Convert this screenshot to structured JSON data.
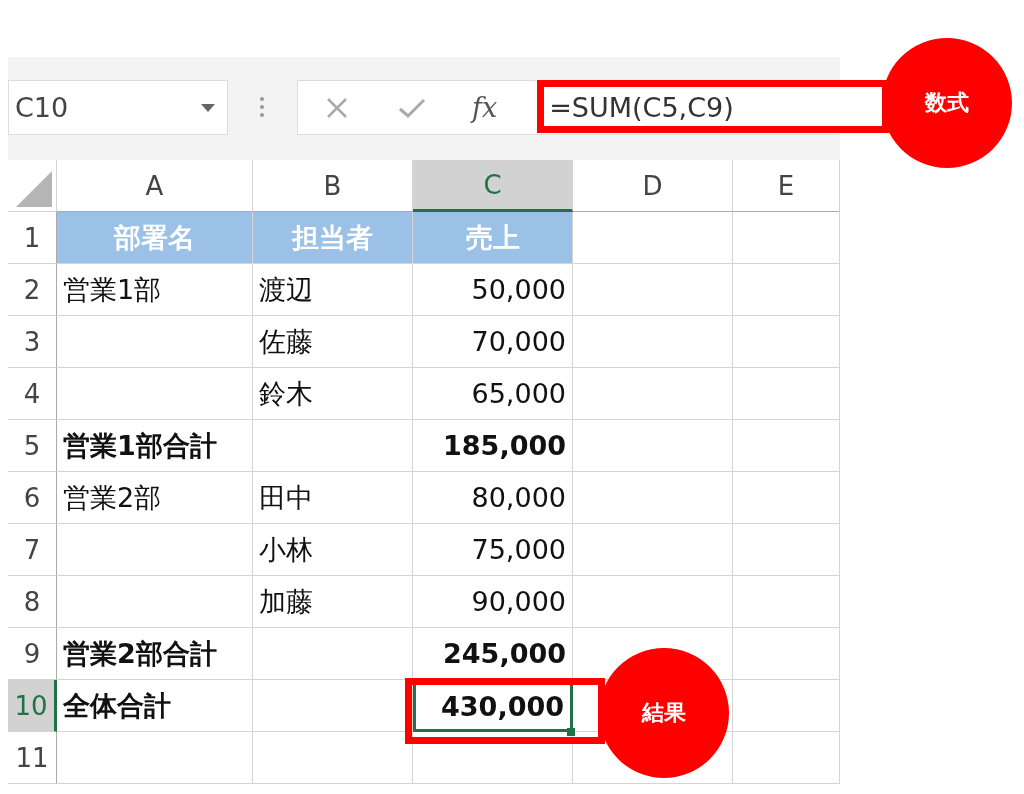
{
  "formula_bar": {
    "name_box": "C10",
    "function_button": "fx",
    "formula": "=SUM(C5,C9)"
  },
  "columns": [
    {
      "label": "A",
      "selected": false
    },
    {
      "label": "B",
      "selected": false
    },
    {
      "label": "C",
      "selected": true
    },
    {
      "label": "D",
      "selected": false
    },
    {
      "label": "E",
      "selected": false
    }
  ],
  "rows": [
    {
      "number": "1",
      "selected": false,
      "kind": "header",
      "dept": "部署名",
      "person": "担当者",
      "sales": "売上"
    },
    {
      "number": "2",
      "selected": false,
      "kind": "data",
      "dept": "営業1部",
      "person": "渡辺",
      "sales": "50,000"
    },
    {
      "number": "3",
      "selected": false,
      "kind": "data",
      "person": "佐藤",
      "sales": "70,000"
    },
    {
      "number": "4",
      "selected": false,
      "kind": "data",
      "person": "鈴木",
      "sales": "65,000"
    },
    {
      "number": "5",
      "selected": false,
      "kind": "total",
      "dept": "営業1部合計",
      "sales": "185,000"
    },
    {
      "number": "6",
      "selected": false,
      "kind": "data",
      "dept": "営業2部",
      "person": "田中",
      "sales": "80,000"
    },
    {
      "number": "7",
      "selected": false,
      "kind": "data",
      "person": "小林",
      "sales": "75,000"
    },
    {
      "number": "8",
      "selected": false,
      "kind": "data",
      "person": "加藤",
      "sales": "90,000"
    },
    {
      "number": "9",
      "selected": false,
      "kind": "total",
      "dept": "営業2部合計",
      "sales": "245,000"
    },
    {
      "number": "10",
      "selected": true,
      "kind": "total",
      "dept": "全体合計",
      "sales": "430,000"
    },
    {
      "number": "11",
      "selected": false,
      "kind": "data"
    }
  ],
  "annotations": [
    {
      "kind": "formula",
      "label": "数式"
    },
    {
      "kind": "result",
      "label": "結果"
    }
  ]
}
